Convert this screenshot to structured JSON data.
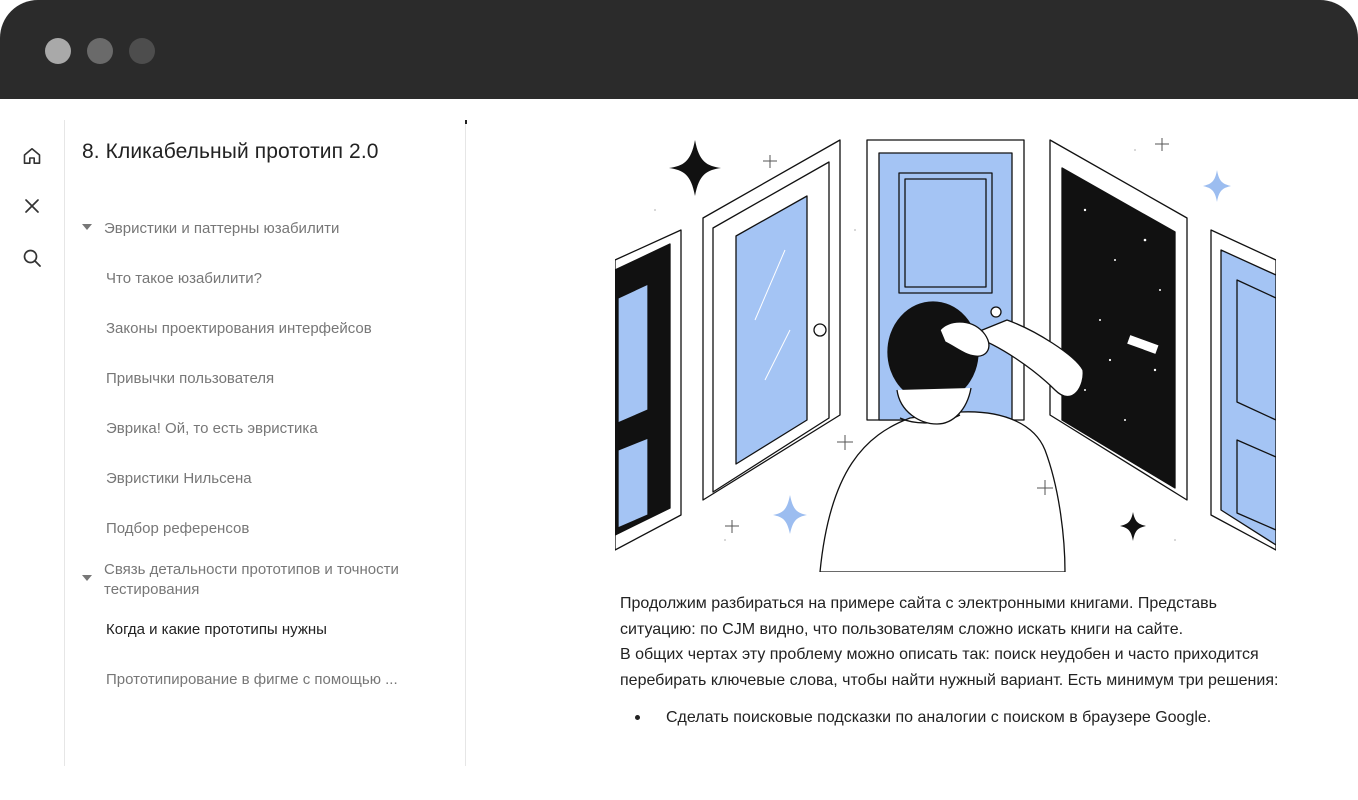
{
  "window": {
    "controls": [
      "close",
      "minimize",
      "zoom"
    ]
  },
  "rail": {
    "icons": [
      {
        "name": "home-icon"
      },
      {
        "name": "close-icon"
      },
      {
        "name": "search-icon"
      }
    ]
  },
  "toc": {
    "title": "8. Кликабельный прототип 2.0",
    "section1": {
      "label": "Эвристики и паттерны юзабилити",
      "items": [
        "Что такое юзабилити?",
        "Законы проектирования интерфейсов",
        "Привычки пользователя",
        "Эврика! Ой, то есть эвристика",
        "Эвристики Нильсена",
        "Подбор референсов"
      ]
    },
    "section2": {
      "label": "Связь детальности прототипов и точности тестирования",
      "items": [
        "Когда и какие прототипы нужны",
        "Прототипирование в фигме с помощью ..."
      ]
    }
  },
  "colors": {
    "door_blue": "#a4c4f4",
    "star_blue": "#9cbdf0",
    "ink": "#111111"
  },
  "content": {
    "paragraph": "Продолжим разбираться на примере сайта с электронными книгами. Представь ситуацию: по CJM видно, что пользователям сложно искать книги на сайте.",
    "paragraph2": "В общих чертах эту проблему можно описать так: поиск неудобен и часто приходится перебирать ключевые слова, чтобы найти нужный вариант. Есть минимум три решения:",
    "bullets": [
      "Сделать поисковые подсказки по аналогии с поиском в браузере Google."
    ]
  }
}
